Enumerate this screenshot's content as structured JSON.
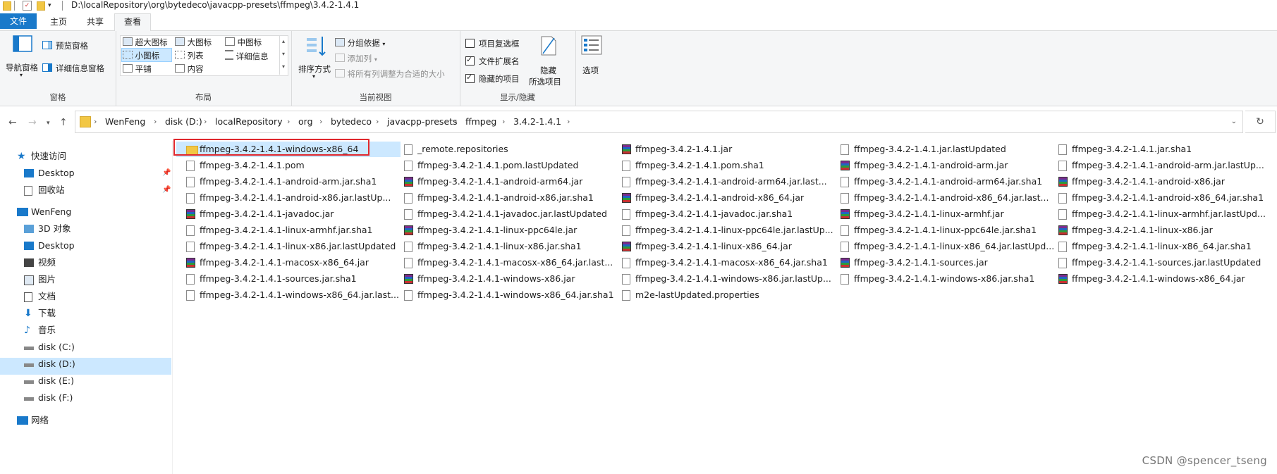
{
  "titlebar": {
    "path": "D:\\localRepository\\org\\bytedeco\\javacpp-presets\\ffmpeg\\3.4.2-1.4.1"
  },
  "tabs": {
    "file": "文件",
    "home": "主页",
    "share": "共享",
    "view": "查看"
  },
  "ribbon": {
    "panes": {
      "nav_pane": "导航窗格",
      "preview": "预览窗格",
      "details": "详细信息窗格",
      "label": "窗格"
    },
    "layout": {
      "extra_large": "超大图标",
      "large": "大图标",
      "medium": "中图标",
      "small": "小图标",
      "list": "列表",
      "details": "详细信息",
      "tiles": "平铺",
      "content": "内容",
      "label": "布局"
    },
    "current_view": {
      "sort": "排序方式",
      "group": "分组依据",
      "add_col": "添加列",
      "fit_cols": "将所有列调整为合适的大小",
      "label": "当前视图"
    },
    "show_hide": {
      "item_checkbox": "项目复选框",
      "file_ext": "文件扩展名",
      "hidden_items": "隐藏的项目",
      "hide": "隐藏",
      "hide_selected": "所选项目",
      "label": "显示/隐藏",
      "item_checkbox_checked": false,
      "file_ext_checked": true,
      "hidden_items_checked": true
    },
    "options": "选项"
  },
  "breadcrumb": [
    "WenFeng",
    "disk (D:)",
    "localRepository",
    "org",
    "bytedeco",
    "javacpp-presets",
    "ffmpeg",
    "3.4.2-1.4.1"
  ],
  "navpane": {
    "quick_access": "快速访问",
    "desktop_pinned": "Desktop",
    "recycle": "回收站",
    "pc": "WenFeng",
    "objects3d": "3D 对象",
    "desktop": "Desktop",
    "videos": "视频",
    "pictures": "图片",
    "documents": "文档",
    "downloads": "下载",
    "music": "音乐",
    "disk_c": "disk (C:)",
    "disk_d": "disk (D:)",
    "disk_e": "disk (E:)",
    "disk_f": "disk (F:)",
    "network": "网络"
  },
  "files": {
    "col1": [
      {
        "name": "ffmpeg-3.4.2-1.4.1-windows-x86_64",
        "icon": "folder-icon"
      },
      {
        "name": "ffmpeg-3.4.2-1.4.1.pom",
        "icon": "doc-icon"
      },
      {
        "name": "ffmpeg-3.4.2-1.4.1-android-arm.jar.sha1",
        "icon": "doc-icon"
      },
      {
        "name": "ffmpeg-3.4.2-1.4.1-android-x86.jar.lastUp...",
        "icon": "doc-icon"
      },
      {
        "name": "ffmpeg-3.4.2-1.4.1-javadoc.jar",
        "icon": "rar-icon"
      },
      {
        "name": "ffmpeg-3.4.2-1.4.1-linux-armhf.jar.sha1",
        "icon": "doc-icon"
      },
      {
        "name": "ffmpeg-3.4.2-1.4.1-linux-x86.jar.lastUpdated",
        "icon": "doc-icon"
      },
      {
        "name": "ffmpeg-3.4.2-1.4.1-macosx-x86_64.jar",
        "icon": "rar-icon"
      },
      {
        "name": "ffmpeg-3.4.2-1.4.1-sources.jar.sha1",
        "icon": "doc-icon"
      },
      {
        "name": "ffmpeg-3.4.2-1.4.1-windows-x86_64.jar.last...",
        "icon": "doc-icon"
      }
    ],
    "col2": [
      {
        "name": "_remote.repositories",
        "icon": "doc-icon"
      },
      {
        "name": "ffmpeg-3.4.2-1.4.1.pom.lastUpdated",
        "icon": "doc-icon"
      },
      {
        "name": "ffmpeg-3.4.2-1.4.1-android-arm64.jar",
        "icon": "rar-icon"
      },
      {
        "name": "ffmpeg-3.4.2-1.4.1-android-x86.jar.sha1",
        "icon": "doc-icon"
      },
      {
        "name": "ffmpeg-3.4.2-1.4.1-javadoc.jar.lastUpdated",
        "icon": "doc-icon"
      },
      {
        "name": "ffmpeg-3.4.2-1.4.1-linux-ppc64le.jar",
        "icon": "rar-icon"
      },
      {
        "name": "ffmpeg-3.4.2-1.4.1-linux-x86.jar.sha1",
        "icon": "doc-icon"
      },
      {
        "name": "ffmpeg-3.4.2-1.4.1-macosx-x86_64.jar.last...",
        "icon": "doc-icon"
      },
      {
        "name": "ffmpeg-3.4.2-1.4.1-windows-x86.jar",
        "icon": "rar-icon"
      },
      {
        "name": "ffmpeg-3.4.2-1.4.1-windows-x86_64.jar.sha1",
        "icon": "doc-icon"
      }
    ],
    "col3": [
      {
        "name": "ffmpeg-3.4.2-1.4.1.jar",
        "icon": "rar-icon"
      },
      {
        "name": "ffmpeg-3.4.2-1.4.1.pom.sha1",
        "icon": "doc-icon"
      },
      {
        "name": "ffmpeg-3.4.2-1.4.1-android-arm64.jar.last...",
        "icon": "doc-icon"
      },
      {
        "name": "ffmpeg-3.4.2-1.4.1-android-x86_64.jar",
        "icon": "rar-icon"
      },
      {
        "name": "ffmpeg-3.4.2-1.4.1-javadoc.jar.sha1",
        "icon": "doc-icon"
      },
      {
        "name": "ffmpeg-3.4.2-1.4.1-linux-ppc64le.jar.lastUp...",
        "icon": "doc-icon"
      },
      {
        "name": "ffmpeg-3.4.2-1.4.1-linux-x86_64.jar",
        "icon": "rar-icon"
      },
      {
        "name": "ffmpeg-3.4.2-1.4.1-macosx-x86_64.jar.sha1",
        "icon": "doc-icon"
      },
      {
        "name": "ffmpeg-3.4.2-1.4.1-windows-x86.jar.lastUp...",
        "icon": "doc-icon"
      },
      {
        "name": "m2e-lastUpdated.properties",
        "icon": "doc-icon"
      }
    ],
    "col4": [
      {
        "name": "ffmpeg-3.4.2-1.4.1.jar.lastUpdated",
        "icon": "doc-icon"
      },
      {
        "name": "ffmpeg-3.4.2-1.4.1-android-arm.jar",
        "icon": "rar-icon"
      },
      {
        "name": "ffmpeg-3.4.2-1.4.1-android-arm64.jar.sha1",
        "icon": "doc-icon"
      },
      {
        "name": "ffmpeg-3.4.2-1.4.1-android-x86_64.jar.last...",
        "icon": "doc-icon"
      },
      {
        "name": "ffmpeg-3.4.2-1.4.1-linux-armhf.jar",
        "icon": "rar-icon"
      },
      {
        "name": "ffmpeg-3.4.2-1.4.1-linux-ppc64le.jar.sha1",
        "icon": "doc-icon"
      },
      {
        "name": "ffmpeg-3.4.2-1.4.1-linux-x86_64.jar.lastUpd...",
        "icon": "doc-icon"
      },
      {
        "name": "ffmpeg-3.4.2-1.4.1-sources.jar",
        "icon": "rar-icon"
      },
      {
        "name": "ffmpeg-3.4.2-1.4.1-windows-x86.jar.sha1",
        "icon": "doc-icon"
      }
    ],
    "col5": [
      {
        "name": "ffmpeg-3.4.2-1.4.1.jar.sha1",
        "icon": "doc-icon"
      },
      {
        "name": "ffmpeg-3.4.2-1.4.1-android-arm.jar.lastUp...",
        "icon": "doc-icon"
      },
      {
        "name": "ffmpeg-3.4.2-1.4.1-android-x86.jar",
        "icon": "rar-icon"
      },
      {
        "name": "ffmpeg-3.4.2-1.4.1-android-x86_64.jar.sha1",
        "icon": "doc-icon"
      },
      {
        "name": "ffmpeg-3.4.2-1.4.1-linux-armhf.jar.lastUpd...",
        "icon": "doc-icon"
      },
      {
        "name": "ffmpeg-3.4.2-1.4.1-linux-x86.jar",
        "icon": "rar-icon"
      },
      {
        "name": "ffmpeg-3.4.2-1.4.1-linux-x86_64.jar.sha1",
        "icon": "doc-icon"
      },
      {
        "name": "ffmpeg-3.4.2-1.4.1-sources.jar.lastUpdated",
        "icon": "doc-icon"
      },
      {
        "name": "ffmpeg-3.4.2-1.4.1-windows-x86_64.jar",
        "icon": "rar-icon"
      }
    ]
  },
  "watermark": "CSDN @spencer_tseng",
  "colors": {
    "accent": "#1979ca",
    "selection": "#cce8ff",
    "highlight_box": "#e0282e"
  }
}
